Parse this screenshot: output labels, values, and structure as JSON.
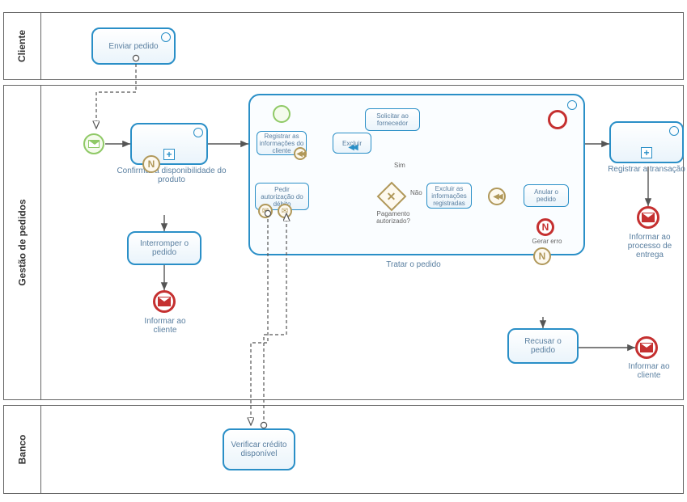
{
  "pools": {
    "cliente": {
      "label": "Cliente"
    },
    "gestao": {
      "label": "Gestão de pedidos"
    },
    "banco": {
      "label": "Banco"
    }
  },
  "tasks": {
    "enviar_pedido": "Enviar pedido",
    "confirm_disp": "Confirmar a disponibilidade do produto",
    "interromper": "Interromper o pedido",
    "tratar": "Tratar o pedido",
    "registrar_tx": "Registrar a transação",
    "recusar": "Recusar o pedido",
    "verificar_cred": "Verificar crédito disponível",
    "reg_info_cli": "Registrar as informações do cliente",
    "excluir_comp": "Excluir",
    "pedir_autoriz": "Pedir autorização do débito",
    "solicitar_forn": "Solicitar ao fornecedor",
    "excluir_info": "Excluir as informações registradas",
    "anular": "Anular o pedido"
  },
  "labels": {
    "informar_cliente": "Informar ao cliente",
    "informar_cliente2": "Informar ao cliente",
    "informar_entrega": "Informar ao processo de entrega",
    "gerar_erro": "Gerar erro",
    "pag_aut": "Pagamento autorizado?",
    "sim": "Sim",
    "nao": "Não"
  }
}
